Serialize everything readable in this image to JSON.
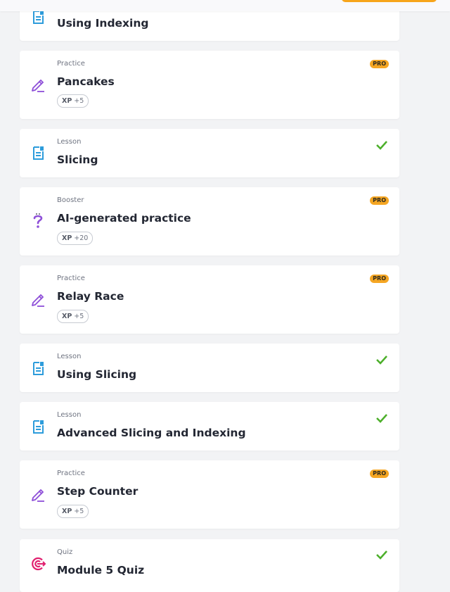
{
  "colors": {
    "background": "#f2f3f5",
    "card": "#ffffff",
    "lesson_icon": "#2d9cdb",
    "practice_icon": "#8e4fd8",
    "booster_icon": "#8e4fd8",
    "quiz_icon": "#e0206f",
    "check": "#4caf2a",
    "pro_badge": "#f5a623"
  },
  "items": [
    {
      "type": "",
      "title": "Using Indexing",
      "icon": "lesson-icon",
      "xp_label": "",
      "xp_value": "",
      "status": "completed"
    },
    {
      "type": "Practice",
      "title": "Pancakes",
      "icon": "pencil-icon",
      "xp_label": "XP",
      "xp_value": "+5",
      "pro_label": "PRO",
      "status": "pro"
    },
    {
      "type": "Lesson",
      "title": "Slicing",
      "icon": "lesson-icon",
      "status": "completed"
    },
    {
      "type": "Booster",
      "title": "AI-generated practice",
      "icon": "question-icon",
      "xp_label": "XP",
      "xp_value": "+20",
      "pro_label": "PRO",
      "status": "pro"
    },
    {
      "type": "Practice",
      "title": "Relay Race",
      "icon": "pencil-icon",
      "xp_label": "XP",
      "xp_value": "+5",
      "pro_label": "PRO",
      "status": "pro"
    },
    {
      "type": "Lesson",
      "title": "Using Slicing",
      "icon": "lesson-icon",
      "status": "completed"
    },
    {
      "type": "Lesson",
      "title": "Advanced Slicing and Indexing",
      "icon": "lesson-icon",
      "status": "completed"
    },
    {
      "type": "Practice",
      "title": "Step Counter",
      "icon": "pencil-icon",
      "xp_label": "XP",
      "xp_value": "+5",
      "pro_label": "PRO",
      "status": "pro"
    },
    {
      "type": "Quiz",
      "title": "Module 5 Quiz",
      "icon": "target-icon",
      "status": "completed"
    }
  ]
}
